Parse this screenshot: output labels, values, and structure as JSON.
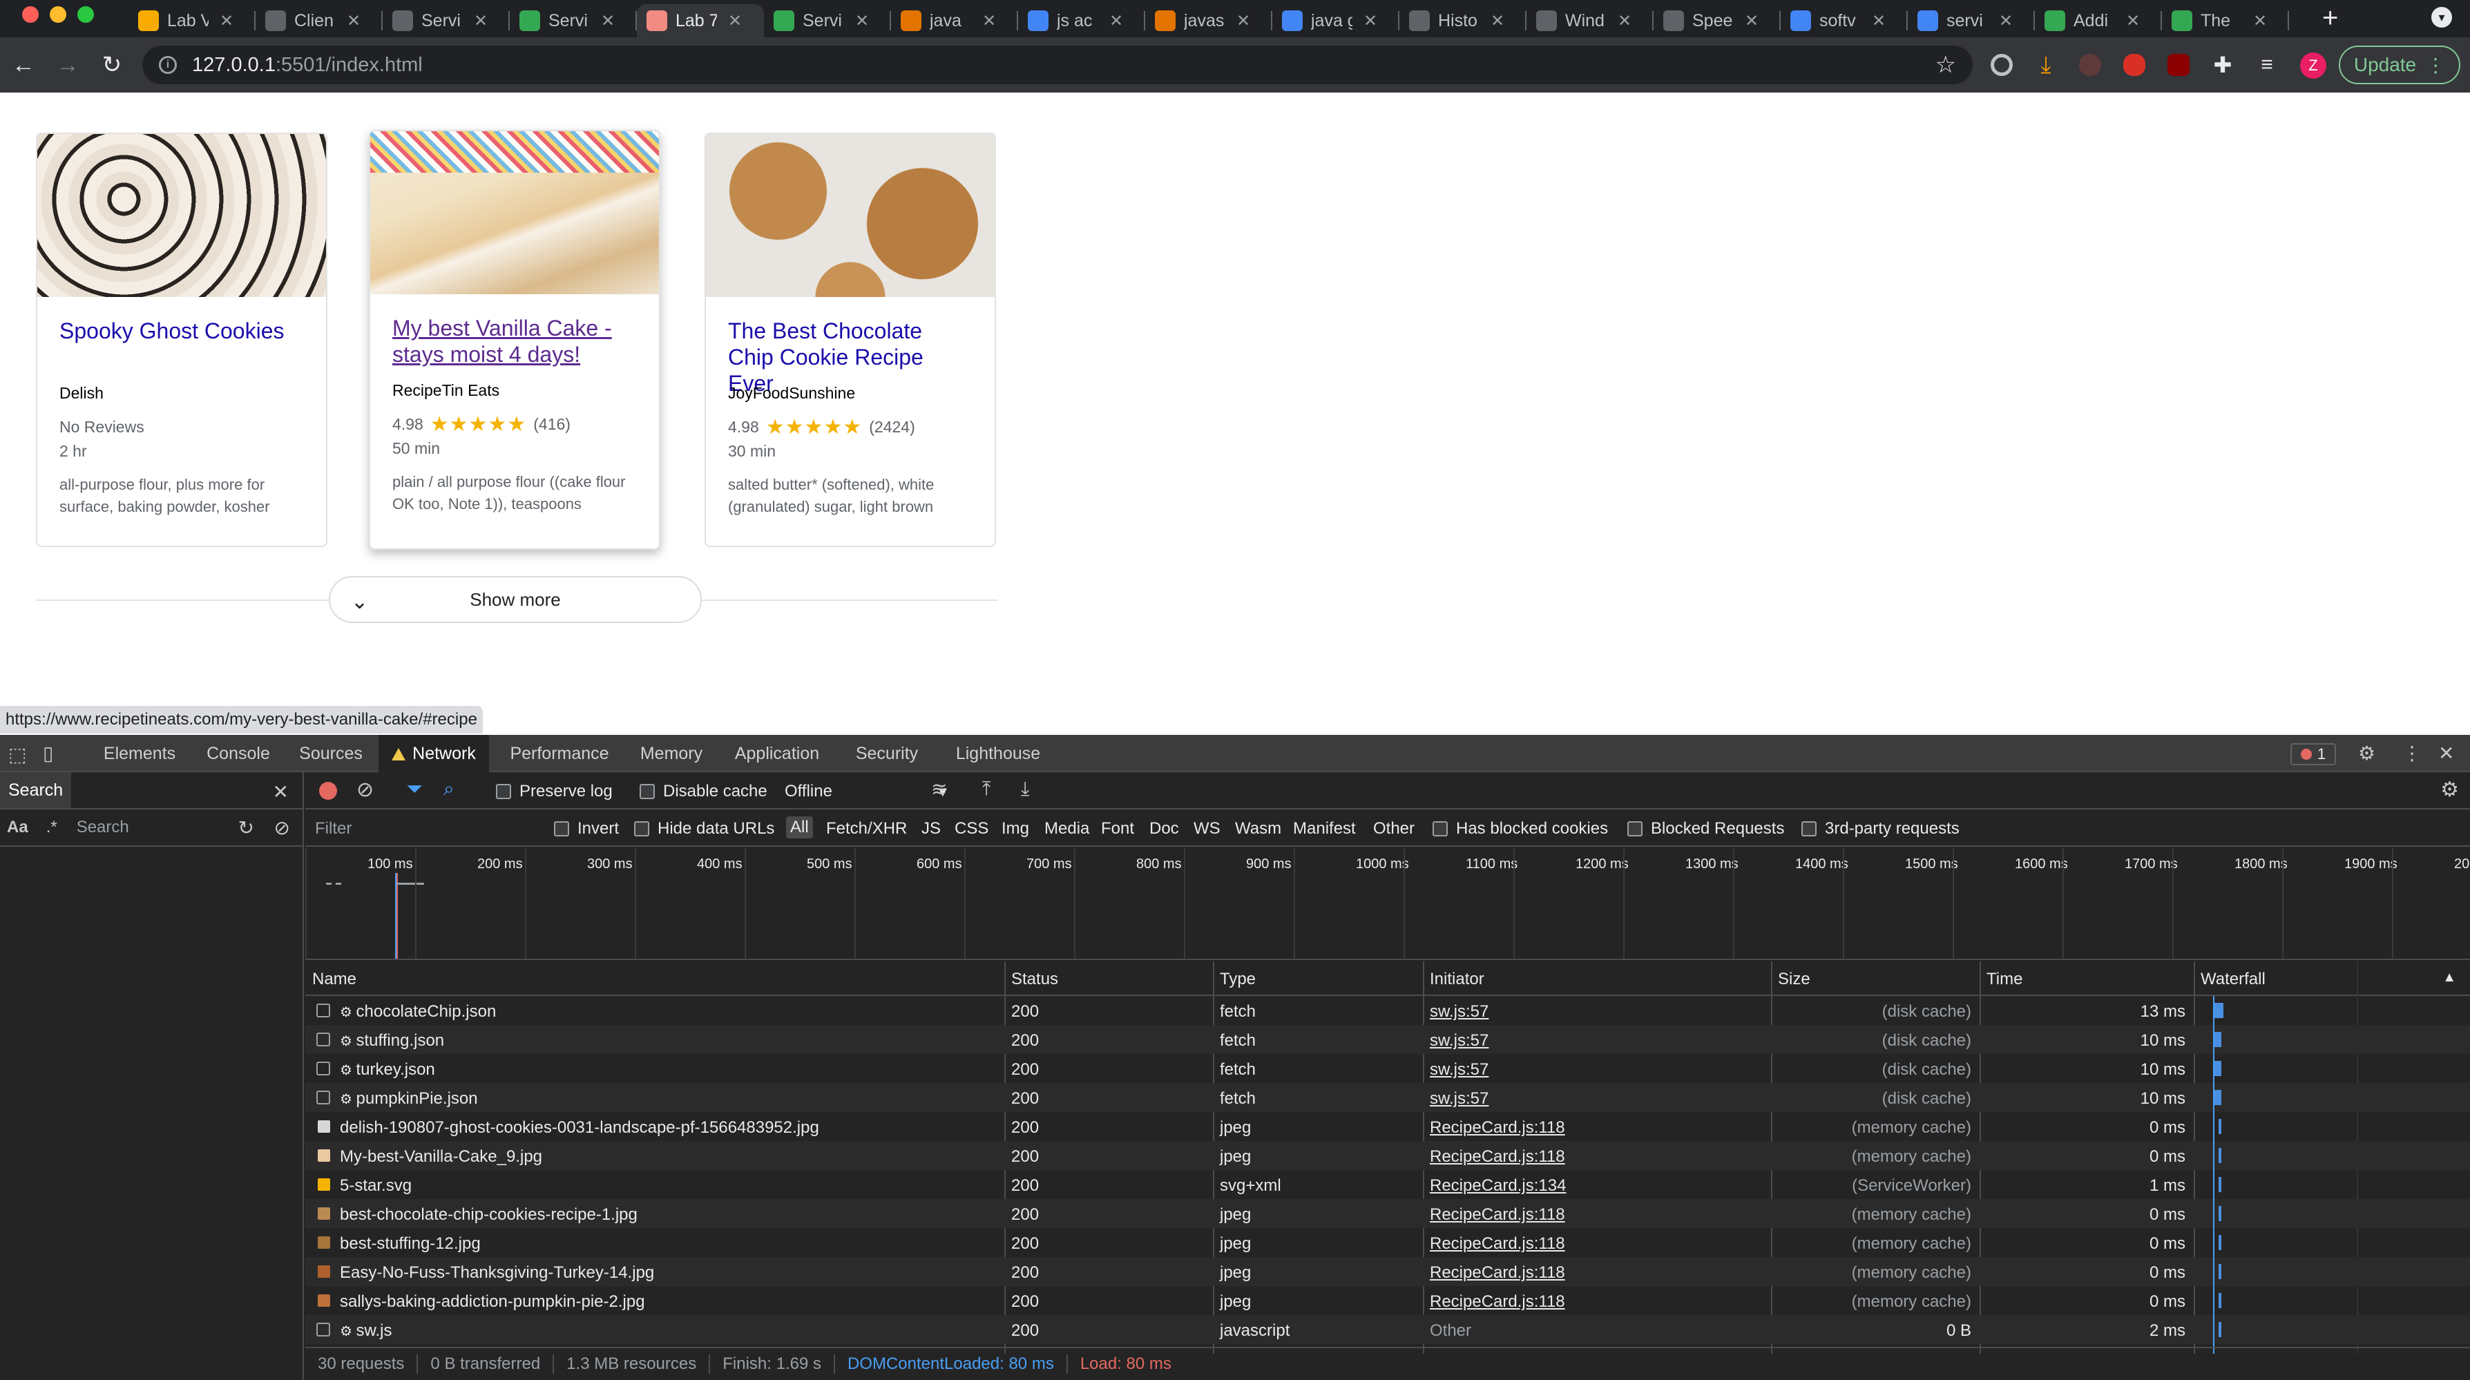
{
  "browser": {
    "tabs": [
      {
        "label": "Lab V",
        "color": "#f9ab00"
      },
      {
        "label": "Clien",
        "color": "#5f6368"
      },
      {
        "label": "Servi",
        "color": "#5f6368"
      },
      {
        "label": "Servi",
        "color": "#34a853"
      },
      {
        "label": "Lab 7",
        "color": "#f28b82",
        "active": true
      },
      {
        "label": "Servi",
        "color": "#34a853"
      },
      {
        "label": "java",
        "color": "#e37400"
      },
      {
        "label": "js ac",
        "color": "#4285f4"
      },
      {
        "label": "javas",
        "color": "#e37400"
      },
      {
        "label": "java g",
        "color": "#4285f4"
      },
      {
        "label": "Histo",
        "color": "#5f6368"
      },
      {
        "label": "Wind",
        "color": "#5f6368"
      },
      {
        "label": "Spee",
        "color": "#5f6368"
      },
      {
        "label": "softv",
        "color": "#4285f4"
      },
      {
        "label": "servi",
        "color": "#4285f4"
      },
      {
        "label": "Addi",
        "color": "#34a853"
      },
      {
        "label": "The",
        "color": "#34a853"
      }
    ],
    "url_host": "127.0.0.1",
    "url_rest": ":5501/index.html",
    "update_label": "Update",
    "avatar_letter": "Z",
    "new_tab_symbol": "+"
  },
  "recipes": [
    {
      "title": "Spooky Ghost Cookies",
      "org": "Delish",
      "rating_text": "No Reviews",
      "rating_value": "",
      "stars": "",
      "reviews": "",
      "time": "2 hr",
      "ingredients": "all-purpose flour, plus more for surface, baking powder, kosher"
    },
    {
      "title": "My best Vanilla Cake - stays moist 4 days!",
      "org": "RecipeTin Eats",
      "rating_text": "",
      "rating_value": "4.98",
      "stars": "★★★★★",
      "reviews": "(416)",
      "time": "50 min",
      "ingredients": "plain / all purpose flour ((cake flour OK too, Note 1)), teaspoons"
    },
    {
      "title": "The Best Chocolate Chip Cookie Recipe Ever",
      "org": "JoyFoodSunshine",
      "rating_text": "",
      "rating_value": "4.98",
      "stars": "★★★★★",
      "reviews": "(2424)",
      "time": "30 min",
      "ingredients": "salted butter* (softened), white (granulated) sugar, light brown"
    }
  ],
  "show_more_label": "Show more",
  "status_url": "https://www.recipetineats.com/my-very-best-vanilla-cake/#recipe",
  "devtools": {
    "tabs": [
      "Elements",
      "Console",
      "Sources",
      "Network",
      "Performance",
      "Memory",
      "Application",
      "Security",
      "Lighthouse"
    ],
    "error_count": "1",
    "search_label": "Search",
    "search_placeholder": "Search",
    "match_case": "Aa",
    "regex": ".*",
    "preserve_log": "Preserve log",
    "disable_cache": "Disable cache",
    "throttle": "Offline",
    "filter_placeholder": "Filter",
    "invert": "Invert",
    "hide_data_urls": "Hide data URLs",
    "type_filters": [
      "All",
      "Fetch/XHR",
      "JS",
      "CSS",
      "Img",
      "Media",
      "Font",
      "Doc",
      "WS",
      "Wasm",
      "Manifest",
      "Other"
    ],
    "has_blocked_cookies": "Has blocked cookies",
    "blocked_requests": "Blocked Requests",
    "third_party": "3rd-party requests",
    "timeline_ticks": [
      "100 ms",
      "200 ms",
      "300 ms",
      "400 ms",
      "500 ms",
      "600 ms",
      "700 ms",
      "800 ms",
      "900 ms",
      "1000 ms",
      "1100 ms",
      "1200 ms",
      "1300 ms",
      "1400 ms",
      "1500 ms",
      "1600 ms",
      "1700 ms",
      "1800 ms",
      "1900 ms",
      "200"
    ],
    "columns": {
      "name": "Name",
      "status": "Status",
      "type": "Type",
      "initiator": "Initiator",
      "size": "Size",
      "time": "Time",
      "waterfall": "Waterfall"
    },
    "requests": [
      {
        "name": "chocolateChip.json",
        "gear": true,
        "status": "200",
        "type": "fetch",
        "initiator": "sw.js:57",
        "size": "(disk cache)",
        "time": "13 ms",
        "icon": "none"
      },
      {
        "name": "stuffing.json",
        "gear": true,
        "status": "200",
        "type": "fetch",
        "initiator": "sw.js:57",
        "size": "(disk cache)",
        "time": "10 ms",
        "icon": "none"
      },
      {
        "name": "turkey.json",
        "gear": true,
        "status": "200",
        "type": "fetch",
        "initiator": "sw.js:57",
        "size": "(disk cache)",
        "time": "10 ms",
        "icon": "none"
      },
      {
        "name": "pumpkinPie.json",
        "gear": true,
        "status": "200",
        "type": "fetch",
        "initiator": "sw.js:57",
        "size": "(disk cache)",
        "time": "10 ms",
        "icon": "none"
      },
      {
        "name": "delish-190807-ghost-cookies-0031-landscape-pf-1566483952.jpg",
        "gear": false,
        "status": "200",
        "type": "jpeg",
        "initiator": "RecipeCard.js:118",
        "size": "(memory cache)",
        "time": "0 ms",
        "icon": "#d7d7d7"
      },
      {
        "name": "My-best-Vanilla-Cake_9.jpg",
        "gear": false,
        "status": "200",
        "type": "jpeg",
        "initiator": "RecipeCard.js:118",
        "size": "(memory cache)",
        "time": "0 ms",
        "icon": "#e8c9a0"
      },
      {
        "name": "5-star.svg",
        "gear": false,
        "status": "200",
        "type": "svg+xml",
        "initiator": "RecipeCard.js:134",
        "size": "(ServiceWorker)",
        "time": "1 ms",
        "icon": "#f5b301"
      },
      {
        "name": "best-chocolate-chip-cookies-recipe-1.jpg",
        "gear": false,
        "status": "200",
        "type": "jpeg",
        "initiator": "RecipeCard.js:118",
        "size": "(memory cache)",
        "time": "0 ms",
        "icon": "#b98b52"
      },
      {
        "name": "best-stuffing-12.jpg",
        "gear": false,
        "status": "200",
        "type": "jpeg",
        "initiator": "RecipeCard.js:118",
        "size": "(memory cache)",
        "time": "0 ms",
        "icon": "#a7743a"
      },
      {
        "name": "Easy-No-Fuss-Thanksgiving-Turkey-14.jpg",
        "gear": false,
        "status": "200",
        "type": "jpeg",
        "initiator": "RecipeCard.js:118",
        "size": "(memory cache)",
        "time": "0 ms",
        "icon": "#b0602c"
      },
      {
        "name": "sallys-baking-addiction-pumpkin-pie-2.jpg",
        "gear": false,
        "status": "200",
        "type": "jpeg",
        "initiator": "RecipeCard.js:118",
        "size": "(memory cache)",
        "time": "0 ms",
        "icon": "#c0703a"
      },
      {
        "name": "sw.js",
        "gear": true,
        "status": "200",
        "type": "javascript",
        "initiator": "Other",
        "size": "0 B",
        "time": "2 ms",
        "icon": "none"
      }
    ],
    "summary": {
      "requests": "30 requests",
      "transferred": "0 B transferred",
      "resources": "1.3 MB resources",
      "finish": "Finish: 1.69 s",
      "dcl": "DOMContentLoaded: 80 ms",
      "load": "Load: 80 ms"
    }
  },
  "colors": {
    "link": "#1a0dab",
    "visited": "#5c2a8f",
    "star": "#f5b301",
    "dcl": "#4a9ef5",
    "load": "#e46962",
    "update": "#81c995"
  }
}
